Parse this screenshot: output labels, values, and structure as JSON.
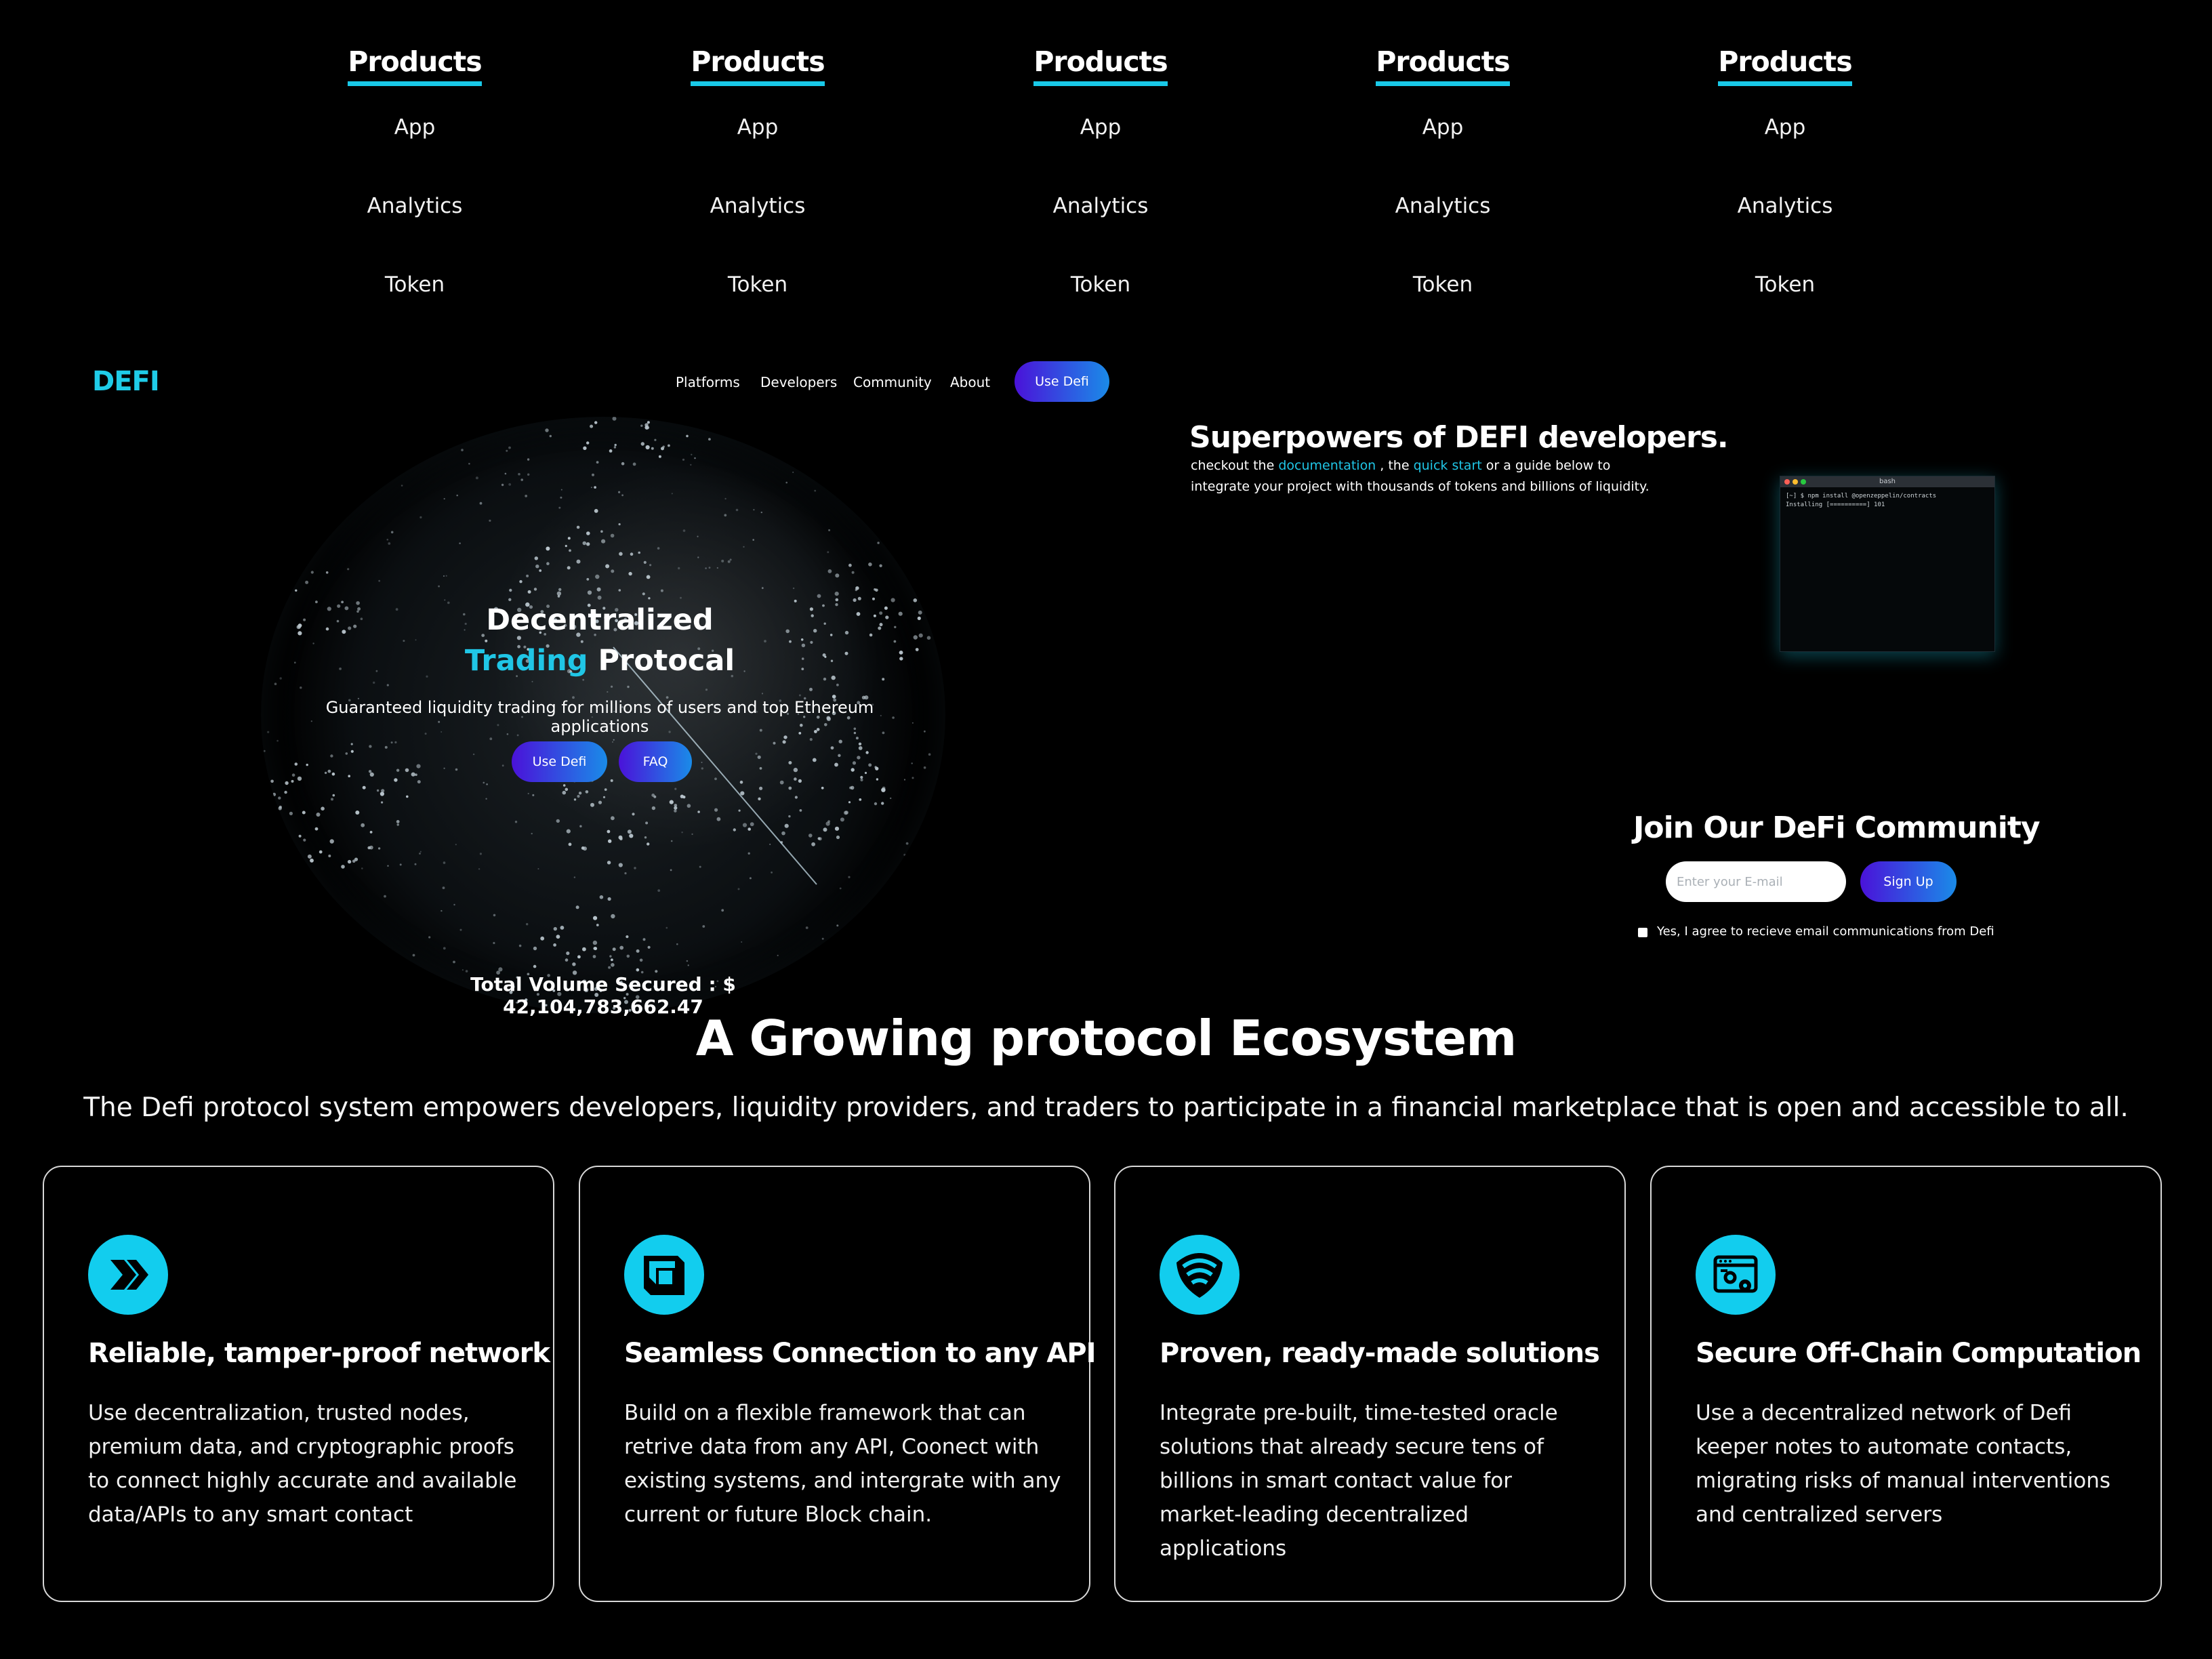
{
  "colors": {
    "accent": "#1fcce8",
    "background": "#000000",
    "button_gradient_start": "#4a12d9",
    "button_gradient_end": "#1a8be8"
  },
  "products_menu": [
    {
      "heading": "Products",
      "items": [
        "App",
        "Analytics",
        "Token"
      ]
    },
    {
      "heading": "Products",
      "items": [
        "App",
        "Analytics",
        "Token"
      ]
    },
    {
      "heading": "Products",
      "items": [
        "App",
        "Analytics",
        "Token"
      ]
    },
    {
      "heading": "Products",
      "items": [
        "App",
        "Analytics",
        "Token"
      ]
    },
    {
      "heading": "Products",
      "items": [
        "App",
        "Analytics",
        "Token"
      ]
    }
  ],
  "nav": {
    "logo": "DEFI",
    "links": [
      "Platforms",
      "Developers",
      "Community",
      "About"
    ],
    "cta": "Use Defi"
  },
  "hero": {
    "title_line1": "Decentralized",
    "title_accent": "Trading",
    "title_rest": " Protocal",
    "subtitle": "Guaranteed liquidity trading for millions of users and top Ethereum applications",
    "btn_primary": "Use Defi",
    "btn_secondary": "FAQ",
    "volume": "Total Volume Secured : $ 42,104,783,662.47"
  },
  "developers": {
    "title": "Superpowers of DEFI developers.",
    "text_1": "checkout the ",
    "link_docs": "documentation",
    "text_2": " , the ",
    "link_quick": "quick start",
    "text_3": " or a guide below to integrate your project with thousands of tokens and billions of liquidity.",
    "terminal": {
      "title": "bash",
      "line1": "[~] $ npm install @openzeppelin/contracts",
      "line2": "Installing [==========] 101"
    }
  },
  "community": {
    "title": "Join Our DeFi Community",
    "email_placeholder": "Enter your E-mail",
    "signup": "Sign Up",
    "agree": "Yes, I agree to recieve email communications from Defi"
  },
  "ecosystem": {
    "title": "A Growing protocol Ecosystem",
    "subtitle": "The Defi protocol system empowers developers, liquidity providers, and traders to participate in a financial marketplace that is open and accessible to all.",
    "cards": [
      {
        "icon": "chevrons-icon",
        "title": "Reliable, tamper-proof network",
        "text": "Use decentralization, trusted nodes, premium data, and cryptographic proofs to connect highly accurate and available data/APIs to any smart contact"
      },
      {
        "icon": "cube-icon",
        "title": "Seamless Connection to any API",
        "text": "Build on a flexible framework that can retrive data from any API, Coonect with existing systems, and intergrate with any current or future Block chain."
      },
      {
        "icon": "shield-wifi-icon",
        "title": "Proven, ready-made solutions",
        "text": "Integrate pre-built, time-tested oracle solutions that already secure tens of billions in smart contact value for market-leading decentralized applications"
      },
      {
        "icon": "browser-gears-icon",
        "title": "Secure Off-Chain Computation",
        "text": "Use a decentralized network of Defi keeper notes to automate contacts, migrating risks of manual interventions and centralized servers"
      }
    ]
  }
}
